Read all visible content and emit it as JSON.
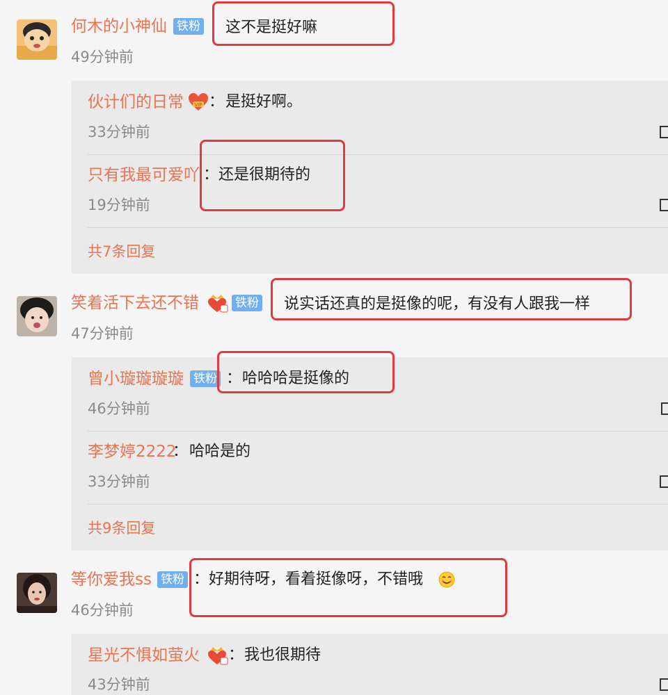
{
  "comments": [
    {
      "username": "何木的小神仙",
      "badge": "铁粉",
      "text": "这不是挺好嘛",
      "time": "49分钟前",
      "replies": [
        {
          "username": "伙计们的日常",
          "text": "是挺好啊。",
          "time": "33分钟前"
        },
        {
          "username": "只有我最可爱吖",
          "text": "还是很期待的",
          "time": "19分钟前"
        }
      ],
      "more": "共7条回复"
    },
    {
      "username": "笑着活下去还不错",
      "badge": "铁粉",
      "text": "说实话还真的是挺像的呢，有没有人跟我一样",
      "time": "47分钟前",
      "replies": [
        {
          "username": "曾小璇璇璇璇",
          "badge": "铁粉",
          "text": "哈哈哈是挺像的",
          "time": "46分钟前"
        },
        {
          "username": "李梦婷2222",
          "text": "哈哈是的",
          "time": "33分钟前"
        }
      ],
      "more": "共9条回复"
    },
    {
      "username": "等你爱我ss",
      "badge": "铁粉",
      "text": "好期待呀，看着挺像呀，不错哦",
      "time": "46分钟前",
      "replies": [
        {
          "username": "星光不惧如萤火",
          "text": "我也很期待",
          "time": "43分钟前"
        }
      ]
    }
  ],
  "punctuation": {
    "colon": "："
  },
  "icons": {
    "vip_heart": "vip-heart-icon",
    "crown_heart": "crown-heart-icon",
    "smile": "smile-emoji-icon",
    "reply": "reply-icon"
  },
  "colors": {
    "username": "#eb7350",
    "badge_bg": "#70aff0",
    "highlight_box": "#e0393e",
    "reply_bg": "#eaeaea"
  }
}
